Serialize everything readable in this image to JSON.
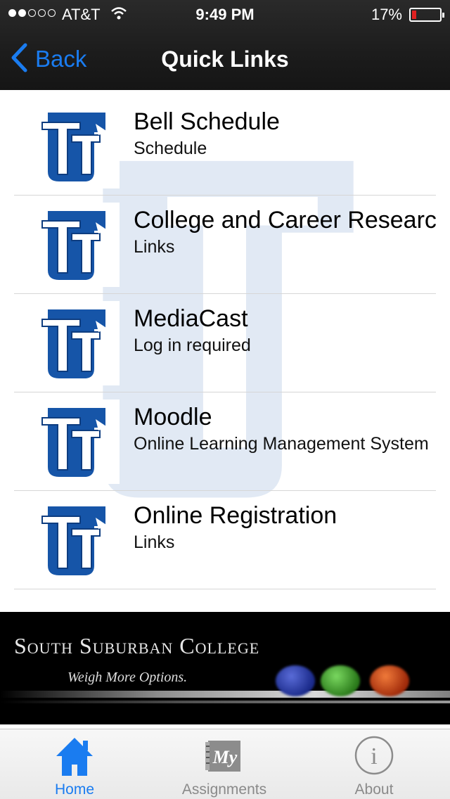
{
  "status_bar": {
    "carrier": "AT&T",
    "time": "9:49 PM",
    "battery": "17%",
    "battery_level": 0.17,
    "signal_bars_filled": 2,
    "signal_bars_total": 5
  },
  "nav": {
    "back_label": "Back",
    "title": "Quick Links",
    "back_icon": "chevron-left-icon"
  },
  "links": [
    {
      "title": "Bell Schedule",
      "subtitle": "Schedule"
    },
    {
      "title": "College and Career Research",
      "subtitle": "Links"
    },
    {
      "title": "MediaCast",
      "subtitle": "Log in required"
    },
    {
      "title": "Moodle",
      "subtitle": "Online Learning Management System"
    },
    {
      "title": "Online Registration",
      "subtitle": "Links"
    }
  ],
  "banner": {
    "college_name": "South Suburban College",
    "tagline": "Weigh More Options."
  },
  "tabbar": {
    "tabs": [
      {
        "label": "Home",
        "icon": "home-icon",
        "active": true
      },
      {
        "label": "Assignments",
        "icon": "assignments-icon",
        "active": false
      },
      {
        "label": "About",
        "icon": "info-icon",
        "active": false
      }
    ]
  },
  "colors": {
    "accent": "#1a7cf0",
    "logo_blue": "#1655a8",
    "nav_bg": "#1c1c1c",
    "battery_low": "#e02020"
  }
}
